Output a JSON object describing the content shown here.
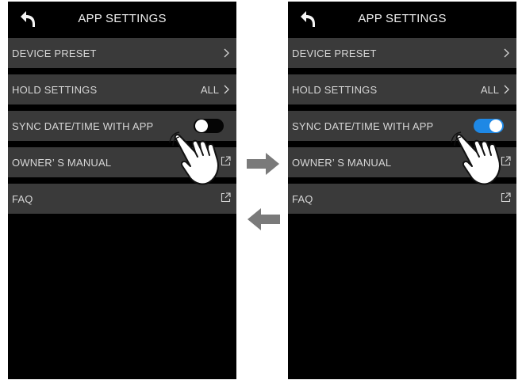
{
  "screens": {
    "left": {
      "title": "APP SETTINGS",
      "items": [
        {
          "label": "DEVICE PRESET",
          "value": "",
          "trailing": "chevron"
        },
        {
          "label": "HOLD SETTINGS",
          "value": "ALL",
          "trailing": "chevron"
        },
        {
          "label": "SYNC DATE/TIME WITH APP",
          "value": "",
          "trailing": "toggle",
          "toggle_on": false
        },
        {
          "label": "OWNER’ S MANUAL",
          "value": "",
          "trailing": "external-link"
        },
        {
          "label": "FAQ",
          "value": "",
          "trailing": "external-link"
        }
      ]
    },
    "right": {
      "title": "APP SETTINGS",
      "items": [
        {
          "label": "DEVICE PRESET",
          "value": "",
          "trailing": "chevron"
        },
        {
          "label": "HOLD SETTINGS",
          "value": "ALL",
          "trailing": "chevron"
        },
        {
          "label": "SYNC DATE/TIME WITH APP",
          "value": "",
          "trailing": "toggle",
          "toggle_on": true
        },
        {
          "label": "OWNER’ S MANUAL",
          "value": "",
          "trailing": "external-link"
        },
        {
          "label": "FAQ",
          "value": "",
          "trailing": "external-link"
        }
      ]
    }
  },
  "colors": {
    "background": "#000000",
    "row": "#3a3a3a",
    "text": "#d6d6d6",
    "toggle_on": "#1e88e5",
    "arrow": "#7a7a7a"
  },
  "icons": {
    "back": "back-arrow-icon",
    "chevron": "chevron-right-icon",
    "external": "external-link-icon",
    "hand": "hand-pointer-icon",
    "transition_forward": "arrow-right-icon",
    "transition_back": "arrow-left-icon"
  }
}
